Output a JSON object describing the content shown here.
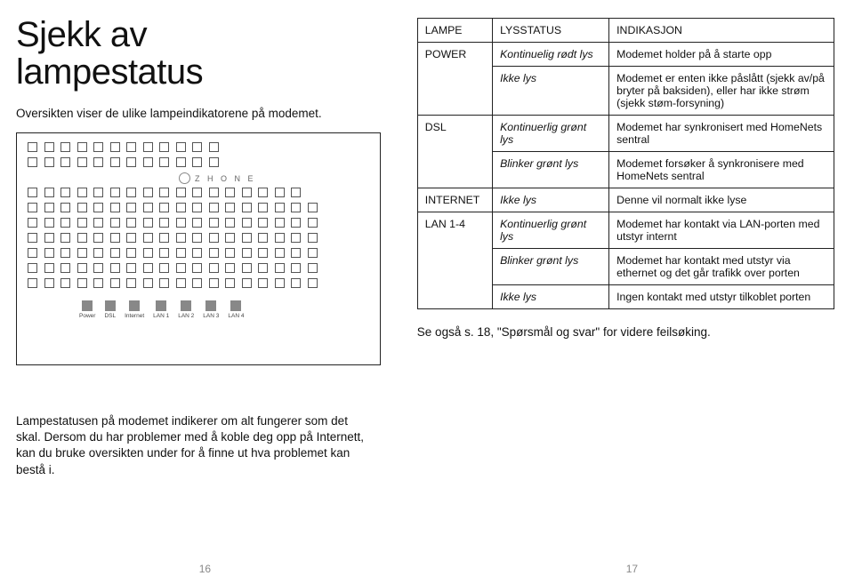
{
  "title_line1": "Sjekk av",
  "title_line2": "lampestatus",
  "subtitle": "Oversikten viser de ulike lampeindikatorene på modemet.",
  "brand": "Z H O N E",
  "ports": [
    "Power",
    "DSL",
    "Internet",
    "LAN 1",
    "LAN 2",
    "LAN 3",
    "LAN 4"
  ],
  "bottom_para": "Lampestatusen på modemet indikerer om alt fungerer som det skal. Dersom du har problemer med å koble deg opp på Internett, kan du bruke oversikten under for å finne ut hva problemet kan bestå i.",
  "page_left": "16",
  "page_right": "17",
  "table": {
    "headers": [
      "LAMPE",
      "LYSSTATUS",
      "INDIKASJON"
    ],
    "groups": [
      {
        "lampe": "POWER",
        "rows": [
          {
            "status": "Kontinuelig rødt lys",
            "ind": "Modemet holder på å starte opp"
          },
          {
            "status": "Ikke lys",
            "ind": "Modemet er enten ikke påslått (sjekk av/på bryter på baksiden), eller har ikke strøm (sjekk støm-forsyning)"
          }
        ]
      },
      {
        "lampe": "DSL",
        "rows": [
          {
            "status": "Kontinuerlig grønt lys",
            "ind": "Modemet har synkronisert med HomeNets sentral"
          },
          {
            "status": "Blinker grønt lys",
            "ind": "Modemet forsøker å synkronisere med HomeNets sentral"
          }
        ]
      },
      {
        "lampe": "INTERNET",
        "rows": [
          {
            "status": "Ikke lys",
            "ind": "Denne vil normalt ikke lyse"
          }
        ]
      },
      {
        "lampe": "LAN 1-4",
        "rows": [
          {
            "status": "Kontinuerlig grønt lys",
            "ind": "Modemet har kontakt via LAN-porten med utstyr internt"
          },
          {
            "status": "Blinker grønt lys",
            "ind": "Modemet har kontakt med utstyr via ethernet og det går trafikk over porten"
          },
          {
            "status": "Ikke lys",
            "ind": "Ingen kontakt med utstyr tilkoblet porten"
          }
        ]
      }
    ]
  },
  "note": "Se også s. 18, \"Spørsmål og svar\" for videre feilsøking."
}
